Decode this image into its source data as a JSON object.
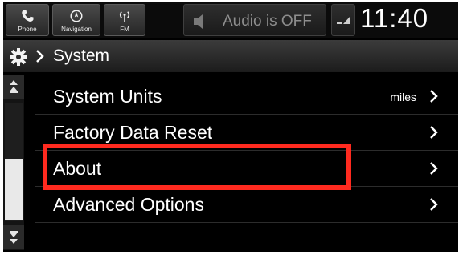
{
  "topbar": {
    "phone_label": "Phone",
    "navigation_label": "Navigation",
    "fm_label": "FM",
    "audio_status": "Audio is OFF",
    "clock": "11:40"
  },
  "title": {
    "text": "System"
  },
  "menu": {
    "items": [
      {
        "label": "System Units",
        "value": "miles"
      },
      {
        "label": "Factory Data Reset",
        "value": ""
      },
      {
        "label": "About",
        "value": ""
      },
      {
        "label": "Advanced Options",
        "value": ""
      }
    ]
  },
  "highlight": {
    "color": "#ff2a1f",
    "target": "About"
  }
}
